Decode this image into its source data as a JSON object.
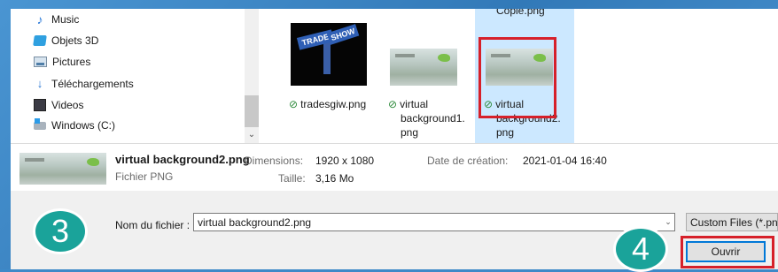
{
  "nav": {
    "items": [
      {
        "label": "Music",
        "icon": "music-icon"
      },
      {
        "label": "Objets 3D",
        "icon": "objects-3d-icon"
      },
      {
        "label": "Pictures",
        "icon": "pictures-icon"
      },
      {
        "label": "Téléchargements",
        "icon": "downloads-icon"
      },
      {
        "label": "Videos",
        "icon": "videos-icon"
      },
      {
        "label": "Windows (C:)",
        "icon": "drive-icon"
      }
    ]
  },
  "files": {
    "top_label": "Copie.png",
    "items": [
      {
        "line1": "tradesgiw.png",
        "line2": "",
        "ts_left": "TRADE",
        "ts_right": "SHOW"
      },
      {
        "line1": "virtual",
        "line2": "background1.",
        "line3": "png"
      },
      {
        "line1": "virtual",
        "line2": "background2.",
        "line3": "png",
        "selected": true
      }
    ]
  },
  "details": {
    "name": "virtual background2.png",
    "type": "Fichier PNG",
    "dimensions_label": "Dimensions:",
    "dimensions_value": "1920 x 1080",
    "size_label": "Taille:",
    "size_value": "3,16 Mo",
    "date_label": "Date de création:",
    "date_value": "2021-01-04 16:40"
  },
  "bottom": {
    "filename_label": "Nom du fichier :",
    "filename_value": "virtual background2.png",
    "filetype_value": "Custom Files (*.png",
    "open_label": "Ouvrir"
  },
  "badges": {
    "step3": "3",
    "step4": "4"
  },
  "colors": {
    "selection": "#cce8ff",
    "highlight": "#d6202a",
    "badge": "#1aa39a",
    "accent": "#0078d7"
  }
}
